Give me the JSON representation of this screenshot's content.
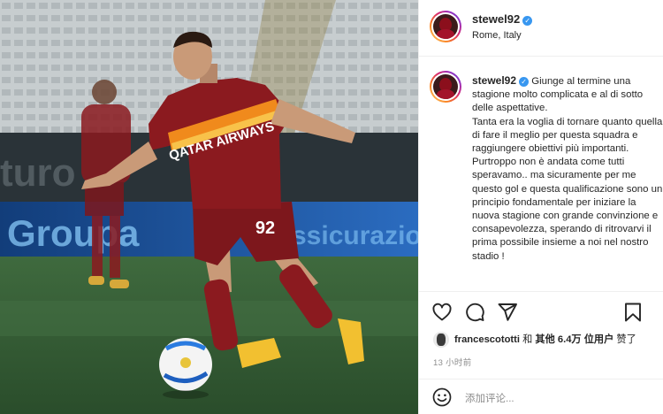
{
  "post": {
    "username": "stewel92",
    "location": "Rome, Italy",
    "caption": "Giunge al termine una stagione molto complicata e al di sotto delle aspettative.\nTanta era la voglia di tornare quanto quella di fare il meglio per questa squadra e raggiungere obiettivi più importanti.\nPurtroppo non è andata come tutti speravamo.. ma sicuramente per me questo gol e questa qualificazione sono un principio fondamentale per iniziare la nuova stagione con grande convinzione e consapevolezza, sperando di ritrovarvi il prima possibile insieme a noi nel nostro stadio !",
    "likes": {
      "user": "francescototti",
      "connector": " 和 ",
      "others_prefix": "其他 ",
      "count": "6.4万",
      "suffix": " 位用户",
      "action": "赞了"
    },
    "time_ago": "13 小时前",
    "comment_placeholder": "添加评论..."
  },
  "photo": {
    "sponsor_text": "QATAR AIRWAYS",
    "shirt_number": "92",
    "background_sign_1": "Groupa",
    "background_sign_2": "ssicurazione",
    "background_sign_3": "turo"
  },
  "icons": [
    "heart-icon",
    "comment-icon",
    "share-icon",
    "bookmark-icon",
    "emoji-icon",
    "verified-icon"
  ],
  "colors": {
    "verified": "#3897f0",
    "roma_red": "#8b1a1f",
    "roma_orange": "#f08a1c",
    "text": "#262626",
    "muted": "#8e8e8e"
  }
}
